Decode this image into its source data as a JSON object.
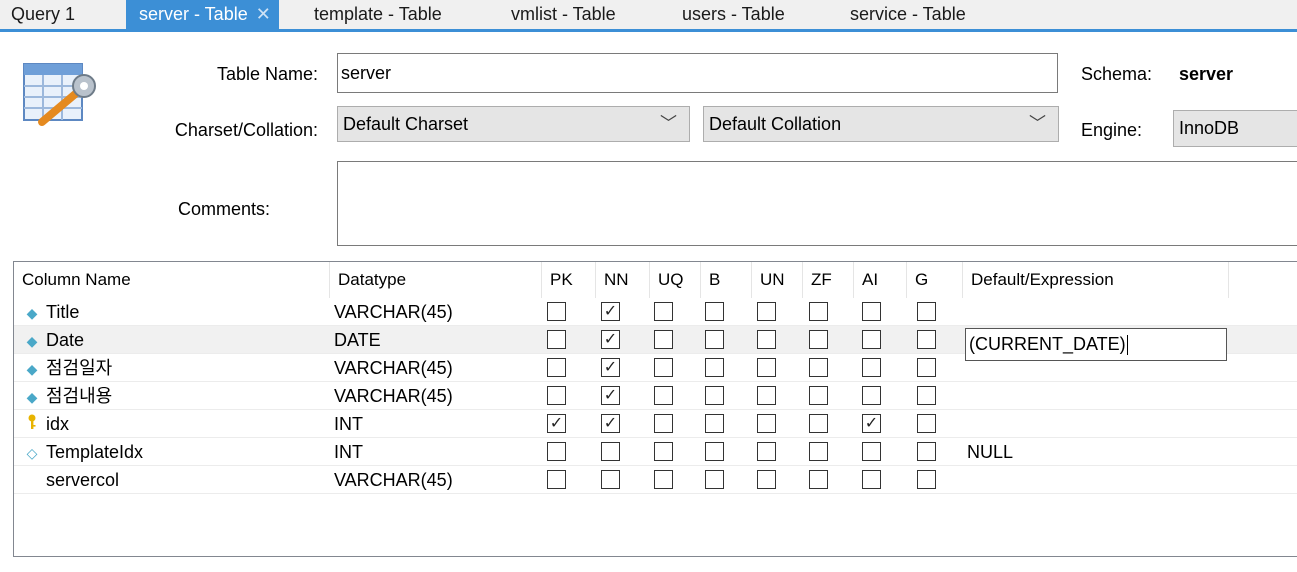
{
  "tabs": [
    {
      "label": "Query 1",
      "active": false
    },
    {
      "label": "server - Table",
      "active": true
    },
    {
      "label": "template - Table",
      "active": false
    },
    {
      "label": "vmlist - Table",
      "active": false
    },
    {
      "label": "users - Table",
      "active": false
    },
    {
      "label": "service - Table",
      "active": false
    }
  ],
  "form": {
    "table_name_label": "Table Name:",
    "table_name_value": "server",
    "schema_label": "Schema:",
    "schema_value": "server",
    "charset_label": "Charset/Collation:",
    "charset_value": "Default Charset",
    "collation_value": "Default Collation",
    "engine_label": "Engine:",
    "engine_value": "InnoDB",
    "comments_label": "Comments:",
    "comments_value": ""
  },
  "grid": {
    "headers": [
      "Column Name",
      "Datatype",
      "PK",
      "NN",
      "UQ",
      "B",
      "UN",
      "ZF",
      "AI",
      "G",
      "Default/Expression"
    ],
    "rows": [
      {
        "name": "Title",
        "icon": "diamond-filled-icon",
        "datatype": "VARCHAR(45)",
        "flags": [
          false,
          true,
          false,
          false,
          false,
          false,
          false,
          false
        ],
        "default": ""
      },
      {
        "name": "Date",
        "icon": "diamond-filled-icon",
        "datatype": "DATE",
        "flags": [
          false,
          true,
          false,
          false,
          false,
          false,
          false,
          false
        ],
        "default": "(CURRENT_DATE)",
        "editing": true
      },
      {
        "name": "점검일자",
        "icon": "diamond-filled-icon",
        "datatype": "VARCHAR(45)",
        "flags": [
          false,
          true,
          false,
          false,
          false,
          false,
          false,
          false
        ],
        "default": ""
      },
      {
        "name": "점검내용",
        "icon": "diamond-filled-icon",
        "datatype": "VARCHAR(45)",
        "flags": [
          false,
          true,
          false,
          false,
          false,
          false,
          false,
          false
        ],
        "default": ""
      },
      {
        "name": "idx",
        "icon": "key-icon",
        "datatype": "INT",
        "flags": [
          true,
          true,
          false,
          false,
          false,
          false,
          true,
          false
        ],
        "default": ""
      },
      {
        "name": "TemplateIdx",
        "icon": "diamond-outline-icon",
        "datatype": "INT",
        "flags": [
          false,
          false,
          false,
          false,
          false,
          false,
          false,
          false
        ],
        "default": "NULL"
      },
      {
        "name": "servercol",
        "icon": "",
        "datatype": "VARCHAR(45)",
        "flags": [
          false,
          false,
          false,
          false,
          false,
          false,
          false,
          false
        ],
        "default": ""
      }
    ]
  },
  "colors": {
    "accent": "#3c8fd6",
    "diamond": "#4aa8c8",
    "key": "#e8b400"
  }
}
